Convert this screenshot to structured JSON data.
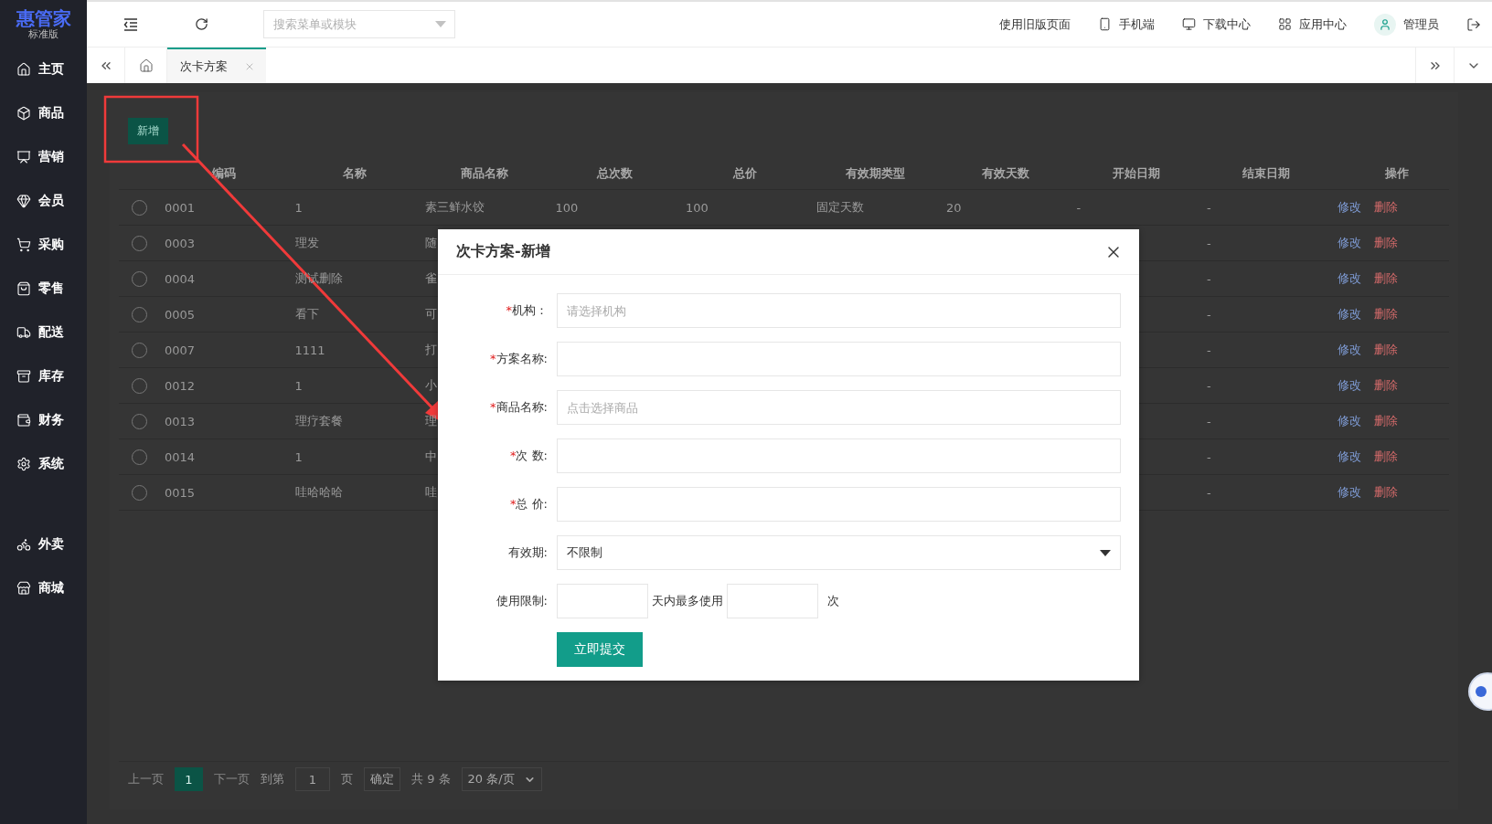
{
  "brand": {
    "name": "惠管家",
    "edition": "标准版"
  },
  "sidebar": {
    "items": [
      {
        "label": "主页"
      },
      {
        "label": "商品"
      },
      {
        "label": "营销"
      },
      {
        "label": "会员"
      },
      {
        "label": "采购"
      },
      {
        "label": "零售"
      },
      {
        "label": "配送"
      },
      {
        "label": "库存"
      },
      {
        "label": "财务"
      },
      {
        "label": "系统"
      }
    ],
    "extra_items": [
      {
        "label": "外卖"
      },
      {
        "label": "商城"
      }
    ]
  },
  "header": {
    "search": {
      "placeholder": "搜索菜单或模块"
    },
    "links": [
      "使用旧版页面",
      "手机端",
      "下载中心",
      "应用中心",
      "管理员"
    ]
  },
  "tabs": [
    {
      "label": "次卡方案",
      "selected": true
    }
  ],
  "toolbar": {
    "add_button": "新增"
  },
  "table": {
    "columns": [
      "编码",
      "名称",
      "商品名称",
      "总次数",
      "总价",
      "有效期类型",
      "有效天数",
      "开始日期",
      "结束日期",
      "操作"
    ],
    "rows": [
      {
        "selected": false,
        "code": "0001",
        "name": "1",
        "product": "素三鲜水饺",
        "total_count": "100",
        "total_price": "100",
        "validity_type": "固定天数",
        "valid_days": "20",
        "start_date": "-",
        "end_date": "-",
        "actions": [
          "修改",
          "删除"
        ]
      },
      {
        "selected": false,
        "code": "0003",
        "name": "理发",
        "product": "随",
        "end_date": "-",
        "actions": [
          "修改",
          "删除"
        ]
      },
      {
        "selected": false,
        "code": "0004",
        "name": "测试删除",
        "product": "雀",
        "end_date": "-",
        "actions": [
          "修改",
          "删除"
        ]
      },
      {
        "selected": false,
        "code": "0005",
        "name": "看下",
        "product": "可",
        "end_date": "-",
        "actions": [
          "修改",
          "删除"
        ]
      },
      {
        "selected": false,
        "code": "0007",
        "name": "1111",
        "product": "打",
        "end_date": "-",
        "actions": [
          "修改",
          "删除"
        ]
      },
      {
        "selected": false,
        "code": "0012",
        "name": "1",
        "product": "小",
        "end_date": "-",
        "actions": [
          "修改",
          "删除"
        ]
      },
      {
        "selected": false,
        "code": "0013",
        "name": "理疗套餐",
        "product": "理",
        "end_date": "-",
        "actions": [
          "修改",
          "删除"
        ]
      },
      {
        "selected": false,
        "code": "0014",
        "name": "1",
        "product": "中",
        "end_date": "-",
        "actions": [
          "修改",
          "删除"
        ]
      },
      {
        "selected": false,
        "code": "0015",
        "name": "哇哈哈哈",
        "product": "哇",
        "end_date": "-",
        "actions": [
          "修改",
          "删除"
        ]
      }
    ]
  },
  "pagination": {
    "prev": "上一页",
    "pages": [
      {
        "label": "1",
        "selected": true
      }
    ],
    "next": "下一页",
    "goto": "到第",
    "page_input": "1",
    "page_unit": "页",
    "confirm": "确定",
    "total": "共 9 条",
    "page_size": "20 条/页"
  },
  "dialog": {
    "title": "次卡方案-新增",
    "fields": [
      {
        "kind": "input",
        "mark": "*",
        "label": "机构：",
        "placeholder": "请选择机构"
      },
      {
        "kind": "input",
        "mark": "*",
        "label": "方案名称:"
      },
      {
        "kind": "input",
        "mark": "*",
        "label": "商品名称:",
        "placeholder": "点击选择商品"
      },
      {
        "kind": "input",
        "mark": "*",
        "label": "次 数:"
      },
      {
        "kind": "input",
        "mark": "*",
        "label": "总 价:"
      },
      {
        "kind": "select",
        "label": "有效期:",
        "value": "不限制"
      },
      {
        "kind": "limit",
        "label": "使用限制:",
        "middle": "天内最多使用",
        "suffix": "次"
      }
    ],
    "submit": "立即提交"
  }
}
